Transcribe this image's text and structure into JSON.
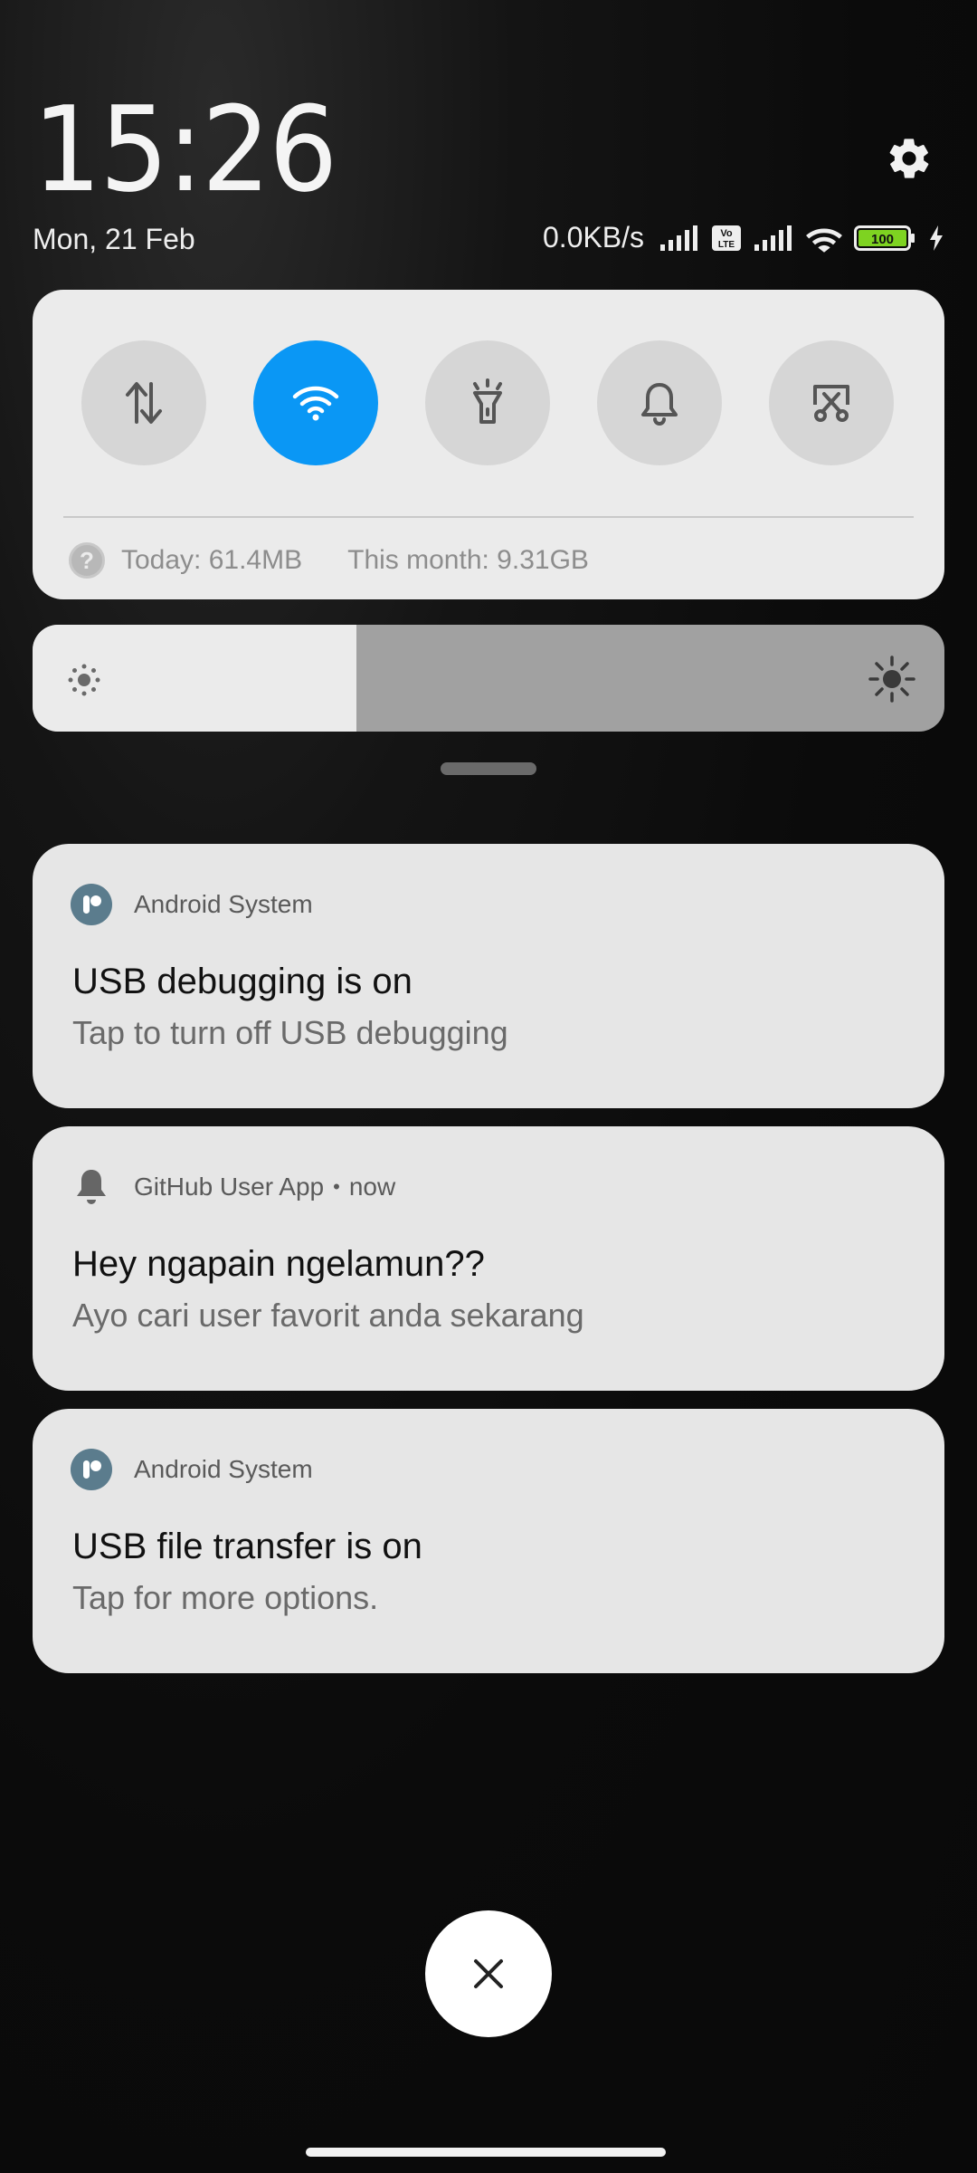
{
  "header": {
    "time": "15:26",
    "date": "Mon, 21 Feb",
    "network_speed": "0.0KB/s",
    "volte_label": "Vo LTE",
    "battery_level": "100",
    "battery_percent": 100
  },
  "quick_settings": {
    "toggles": [
      {
        "name": "mobile-data",
        "icon": "data-transfer-icon",
        "active": false
      },
      {
        "name": "wifi",
        "icon": "wifi-icon",
        "active": true
      },
      {
        "name": "flashlight",
        "icon": "flashlight-icon",
        "active": false
      },
      {
        "name": "sound",
        "icon": "bell-icon",
        "active": false
      },
      {
        "name": "screenshot",
        "icon": "scissors-screen-icon",
        "active": false
      }
    ],
    "data_usage": {
      "today": "Today: 61.4MB",
      "month": "This month: 9.31GB"
    }
  },
  "brightness": {
    "level_percent": 35.5
  },
  "notifications": [
    {
      "app": "Android System",
      "time": "",
      "title": "USB debugging is on",
      "text": "Tap to turn off USB debugging",
      "icon": "android-system-icon"
    },
    {
      "app": "GitHub User App",
      "time": "now",
      "title": "Hey ngapain ngelamun??",
      "text": "Ayo cari user favorit anda sekarang",
      "icon": "bell-icon"
    },
    {
      "app": "Android System",
      "time": "",
      "title": "USB file transfer is on",
      "text": "Tap for more options.",
      "icon": "android-system-icon"
    }
  ],
  "colors": {
    "accent": "#0a97f5",
    "card": "#e6e6e6",
    "background": "#0b0b0b",
    "battery": "#7ed321"
  }
}
